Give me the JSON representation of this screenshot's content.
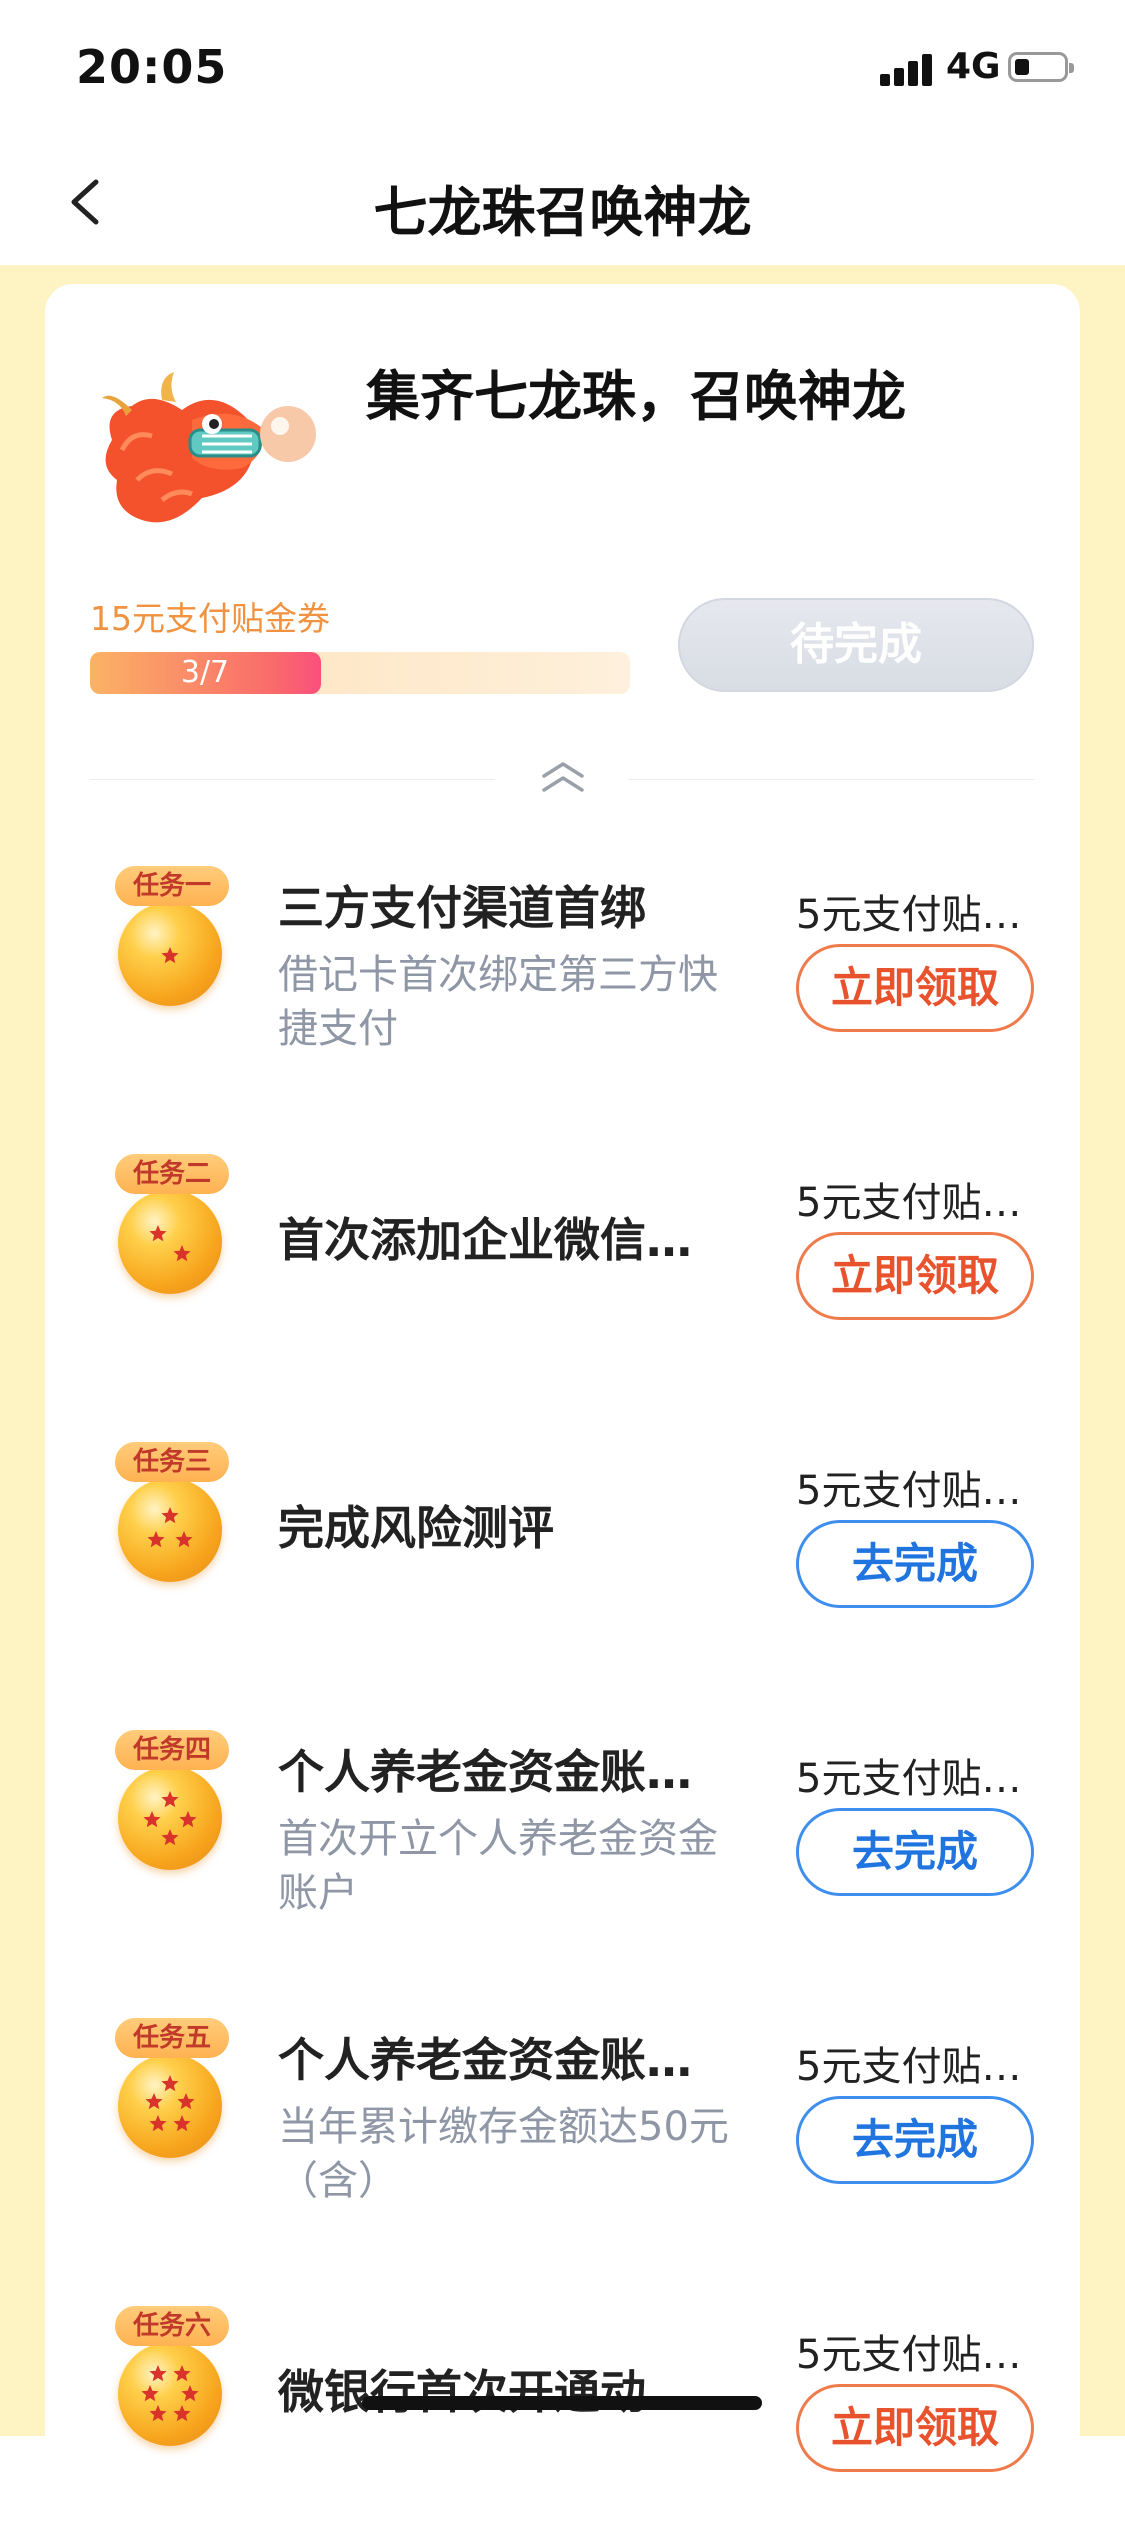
{
  "status_bar": {
    "time": "20:05",
    "network": "4G"
  },
  "nav": {
    "title": "七龙珠召唤神龙"
  },
  "card": {
    "title": "集齐七龙珠，召唤神龙",
    "progress_label": "15元支付贴金券",
    "progress_text": "3/7",
    "progress_fraction": 0.4286,
    "pending_button": "待完成"
  },
  "tasks": [
    {
      "badge": "任务一",
      "stars": 1,
      "title": "三方支付渠道首绑",
      "desc": "借记卡首次绑定第三方快捷支付",
      "reward": "5元支付贴…",
      "action": "立即领取",
      "action_type": "claim"
    },
    {
      "badge": "任务二",
      "stars": 2,
      "title": "首次添加企业微信…",
      "desc": "",
      "reward": "5元支付贴…",
      "action": "立即领取",
      "action_type": "claim"
    },
    {
      "badge": "任务三",
      "stars": 3,
      "title": "完成风险测评",
      "desc": "",
      "reward": "5元支付贴…",
      "action": "去完成",
      "action_type": "go"
    },
    {
      "badge": "任务四",
      "stars": 4,
      "title": "个人养老金资金账…",
      "desc": "首次开立个人养老金资金账户",
      "reward": "5元支付贴…",
      "action": "去完成",
      "action_type": "go"
    },
    {
      "badge": "任务五",
      "stars": 5,
      "title": "个人养老金资金账…",
      "desc": "当年累计缴存金额达50元（含）",
      "reward": "5元支付贴…",
      "action": "去完成",
      "action_type": "go"
    },
    {
      "badge": "任务六",
      "stars": 6,
      "title": "微银行首次开通动…",
      "desc": "",
      "reward": "5元支付贴…",
      "action": "立即领取",
      "action_type": "claim"
    }
  ]
}
